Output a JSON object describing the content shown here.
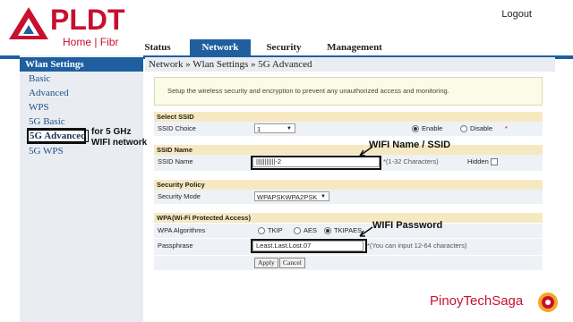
{
  "brand": {
    "name": "PLDT",
    "sub": "Home | Fibr",
    "color": "#c8102e"
  },
  "header": {
    "logout": "Logout"
  },
  "nav": {
    "tabs": [
      "Status",
      "Network",
      "Security",
      "Management"
    ],
    "active": "Network"
  },
  "sidebar": {
    "title": "Wlan Settings",
    "items": [
      "Basic",
      "Advanced",
      "WPS",
      "5G Basic",
      "5G Advanced",
      "5G WPS"
    ],
    "active": "5G Advanced",
    "note_line1": "for 5 GHz",
    "note_line2": "WIFI network"
  },
  "breadcrumb": "Network » Wlan Settings » 5G Advanced",
  "intro": "Setup the wireless security and encryption to prevent any unauthorized access and monitoring.",
  "select_ssid": {
    "header": "Select SSID",
    "label": "SSID Choice",
    "value": "1",
    "enable_label": "Enable",
    "disable_label": "Disable",
    "enabled": true
  },
  "ssid_name": {
    "header": "SSID Name",
    "label": "SSID Name",
    "value": "|||||||||||-2",
    "hint": "*(1-32 Characters)",
    "hidden_label": "Hidden"
  },
  "security_policy": {
    "header": "Security Policy",
    "label": "Security Mode",
    "value": "WPAPSKWPA2PSK"
  },
  "wpa": {
    "header": "WPA(Wi-Fi Protected Access)",
    "alg_label": "WPA Algorithms",
    "alg_options": [
      "TKIP",
      "AES",
      "TKIPAES"
    ],
    "alg_selected": "TKIPAES",
    "pass_label": "Passphrase",
    "pass_value": "Least.Last.Lost.07",
    "pass_hint": "*(You can input 12-64 characters)"
  },
  "buttons": {
    "apply": "Apply",
    "cancel": "Cancel"
  },
  "callouts": {
    "wifi_name": "WIFI Name / SSID",
    "wifi_password": "WIFI Password"
  },
  "watermark": "PinoyTechSaga"
}
